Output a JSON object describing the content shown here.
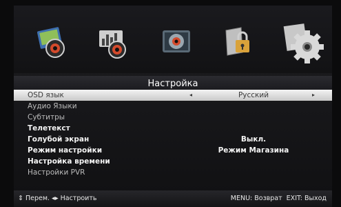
{
  "menu": {
    "title": "Настройка",
    "icons": [
      {
        "name": "picture-icon"
      },
      {
        "name": "sound-icon"
      },
      {
        "name": "channel-icon"
      },
      {
        "name": "lock-icon"
      },
      {
        "name": "settings-gear-icon",
        "active": true
      }
    ],
    "items": [
      {
        "label": "OSD язык",
        "value": "Русский",
        "selected": true,
        "has_arrows": true
      },
      {
        "label": "Аудио Языки",
        "value": "",
        "dim": true
      },
      {
        "label": "Субтитры",
        "value": "",
        "dim": true
      },
      {
        "label": "Телетекст",
        "value": "",
        "bold": true
      },
      {
        "label": "Голубой экран",
        "value": "Выкл.",
        "bold": true
      },
      {
        "label": "Режим настройки",
        "value": "Режим Магазина",
        "bold": true
      },
      {
        "label": "Настройка времени",
        "value": "",
        "bold": true
      },
      {
        "label": "Настройки PVR",
        "value": "",
        "dim": true
      }
    ],
    "arrow_left": "◂",
    "arrow_right": "▸"
  },
  "hints": {
    "left": "⇕ Перем. ◂▸ Настроить",
    "right": "MENU: Возврат  EXIT: Выход"
  },
  "colors": {
    "background": "#141416",
    "selected_row": "#e6e6e6",
    "text": "#ffffff"
  }
}
